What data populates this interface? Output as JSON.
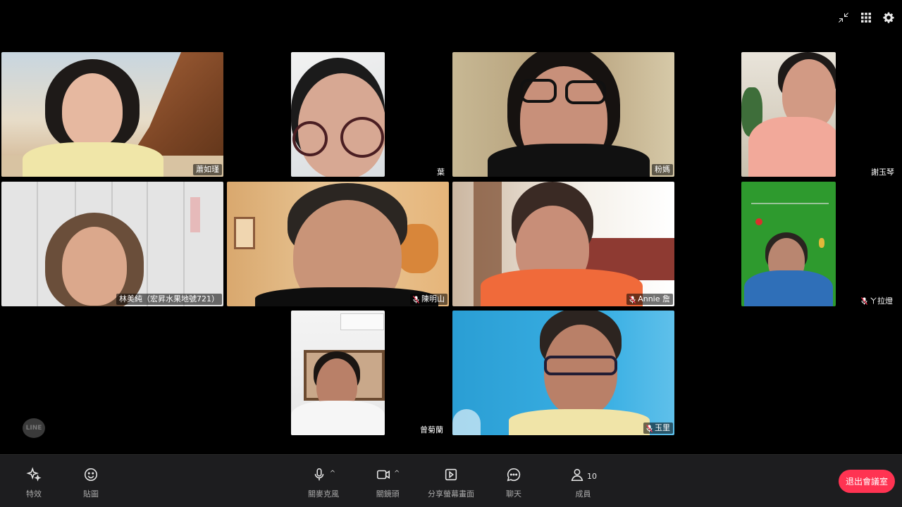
{
  "top_controls": {
    "minimize_icon": "minimize-icon",
    "grid_icon": "grid-layout-icon",
    "settings_icon": "gear-icon"
  },
  "participants": [
    {
      "name": "蕭如瑾",
      "muted": false
    },
    {
      "name": "葉",
      "muted": false
    },
    {
      "name": "粉媽",
      "muted": false
    },
    {
      "name": "謝玉琴",
      "muted": false
    },
    {
      "name": "林美純（宏昇水果地號721）",
      "muted": false
    },
    {
      "name": "陳明山",
      "muted": true
    },
    {
      "name": "Annie 詹",
      "muted": true
    },
    {
      "name": "ㄚ拉燈",
      "muted": true
    },
    {
      "name": "曾菊蘭",
      "muted": false
    },
    {
      "name": "玉里",
      "muted": true
    }
  ],
  "watermark": "LINE",
  "toolbar": {
    "effects_label": "特效",
    "stickers_label": "貼圖",
    "mic_label": "關麥克風",
    "camera_label": "關鏡頭",
    "share_label": "分享螢幕畫面",
    "chat_label": "聊天",
    "members_label": "成員",
    "members_count": "10",
    "leave_label": "退出會議室"
  },
  "colors": {
    "leave_button": "#ff3352",
    "toolbar_bg": "#1d1d1f",
    "background": "#000000"
  }
}
